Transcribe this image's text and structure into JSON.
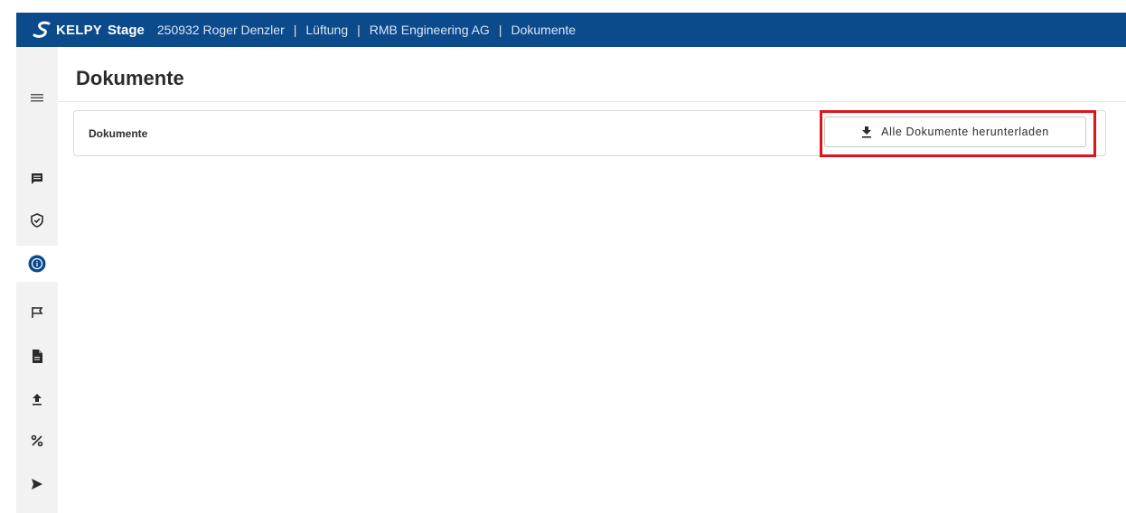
{
  "header": {
    "logo_text": "KELPY",
    "stage_text": "Stage",
    "breadcrumb": [
      "250932 Roger Denzler",
      "Lüftung",
      "RMB Engineering AG",
      "Dokumente"
    ],
    "separator": "|",
    "bg_color": "#0b4a8b"
  },
  "sidebar": {
    "items": [
      {
        "icon": "menu-icon"
      },
      {
        "icon": "comment-icon"
      },
      {
        "icon": "shield-check-icon"
      },
      {
        "icon": "info-icon",
        "active": true
      },
      {
        "icon": "flag-icon"
      },
      {
        "icon": "document-icon"
      },
      {
        "icon": "upload-icon"
      },
      {
        "icon": "percent-icon"
      },
      {
        "icon": "send-icon"
      }
    ],
    "active_color": "#0b4a8b"
  },
  "main": {
    "title": "Dokumente",
    "card": {
      "title": "Dokumente",
      "download_label": "Alle Dokumente herunterladen",
      "download_icon": "download-icon"
    }
  },
  "colors": {
    "highlight": "#e0131b"
  }
}
